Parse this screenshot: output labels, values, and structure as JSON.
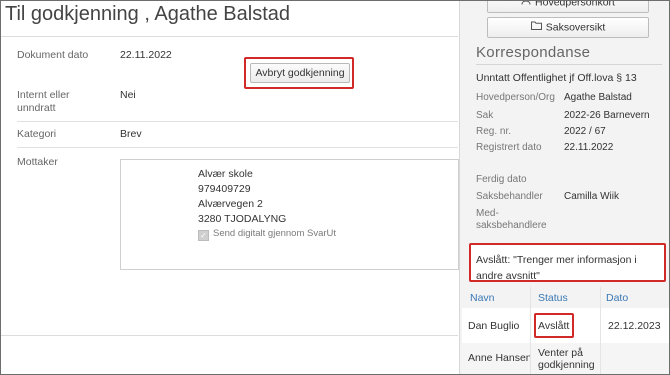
{
  "page": {
    "title": "Til godkjenning , Agathe Balstad"
  },
  "document": {
    "date_label": "Dokument dato",
    "date_value": "22.11.2022",
    "abort_button": "Avbryt godkjenning",
    "internal_label": "Internt eller unndratt",
    "internal_value": "Nei",
    "category_label": "Kategori",
    "category_value": "Brev",
    "recipient_label": "Mottaker"
  },
  "recipient": {
    "name": "Alvær skole",
    "org_number": "979409729",
    "street": "Alværvegen 2",
    "postal": "3280 TJODALYNG",
    "send_digital_label": "Send digitalt gjennom SvarUt",
    "send_digital_checked": true
  },
  "sidebar": {
    "button_person": "Hovedpersonkort",
    "button_case": "Saksoversikt",
    "section_title": "Korrespondanse",
    "classification": "Unntatt Offentlighet jf Off.lova § 13",
    "fields": {
      "person_label": "Hovedperson/Org",
      "person_value": "Agathe Balstad",
      "case_label": "Sak",
      "case_value": "2022-26 Barnevern",
      "reg_label": "Reg. nr.",
      "reg_value": "2022 / 67",
      "registered_label": "Registrert dato",
      "registered_value": "22.11.2022",
      "finished_label": "Ferdig dato",
      "handler_label": "Saksbehandler",
      "handler_value": "Camilla Wiik",
      "co_handler_label": "Med-saksbehandlere"
    },
    "rejection": "Avslått: \"Trenger mer informasjon i andre avsnitt\""
  },
  "approvals": {
    "headers": [
      "Navn",
      "Status",
      "Dato"
    ],
    "rows": [
      {
        "name": "Dan Buglio",
        "status": "Avslått",
        "date": "22.12.2023"
      },
      {
        "name": "Anne Hansen",
        "status": "Venter på godkjenning",
        "date": ""
      }
    ]
  },
  "colors": {
    "highlight": "#d12828",
    "link": "#3a78b5"
  }
}
